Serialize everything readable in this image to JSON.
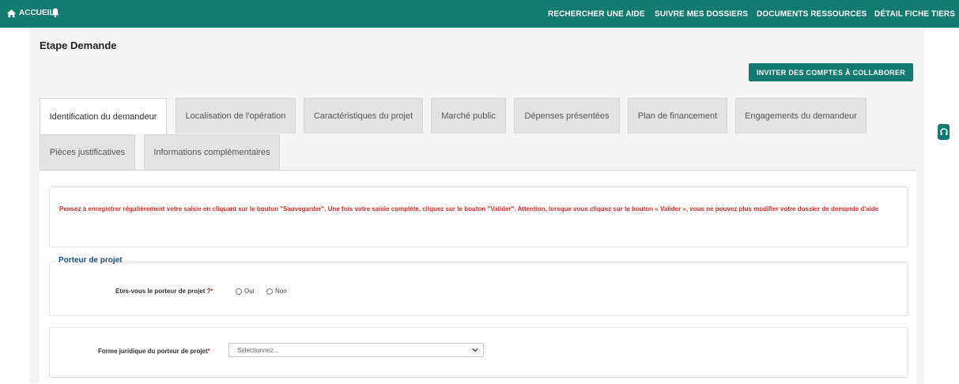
{
  "topnav": {
    "home_label": "ACCUEIL",
    "links": [
      "RECHERCHER UNE AIDE",
      "SUIVRE MES DOSSIERS",
      "DOCUMENTS RESSOURCES",
      "DÉTAIL FICHE TIERS"
    ]
  },
  "page": {
    "title": "Etape Demande",
    "invite_button": "INVITER DES COMPTES À COLLABORER"
  },
  "tabs": [
    {
      "label": "Identification du demandeur",
      "active": true
    },
    {
      "label": "Localisation de l'opération",
      "active": false
    },
    {
      "label": "Caractéristiques du projet",
      "active": false
    },
    {
      "label": "Marché public",
      "active": false
    },
    {
      "label": "Dépenses présentées",
      "active": false
    },
    {
      "label": "Plan de financement",
      "active": false
    },
    {
      "label": "Engagements du demandeur",
      "active": false
    },
    {
      "label": "Pièces justificatives",
      "active": false
    },
    {
      "label": "Informations complémentaires",
      "active": false
    }
  ],
  "alert": {
    "text": "Pensez à enregistrer régulièrement votre saisie en cliquant sur le bouton \"Sauvegarder\". Une fois votre saisie complète, cliquez sur le bouton \"Valider\". Attention, lorsque vous cliquez sur le bouton « Valider », vous ne pouvez plus modifier votre dossier de demande d'aide"
  },
  "porteur": {
    "legend": "Porteur de projet",
    "question": "Etes-vous le porteur de projet ?",
    "required_mark": "*",
    "option_yes": "Oui",
    "option_no": "Non"
  },
  "forme": {
    "label": "Forme juridique du porteur de projet",
    "required_mark": "*",
    "select_value": "Sélectionnez..."
  },
  "colors": {
    "brand": "#137a70",
    "alert": "#e5262a",
    "legend": "#1f4e79"
  },
  "icons": {
    "home": "home-icon",
    "bell": "bell-icon",
    "headset": "headset-icon",
    "chevron": "chevron-down-icon"
  }
}
